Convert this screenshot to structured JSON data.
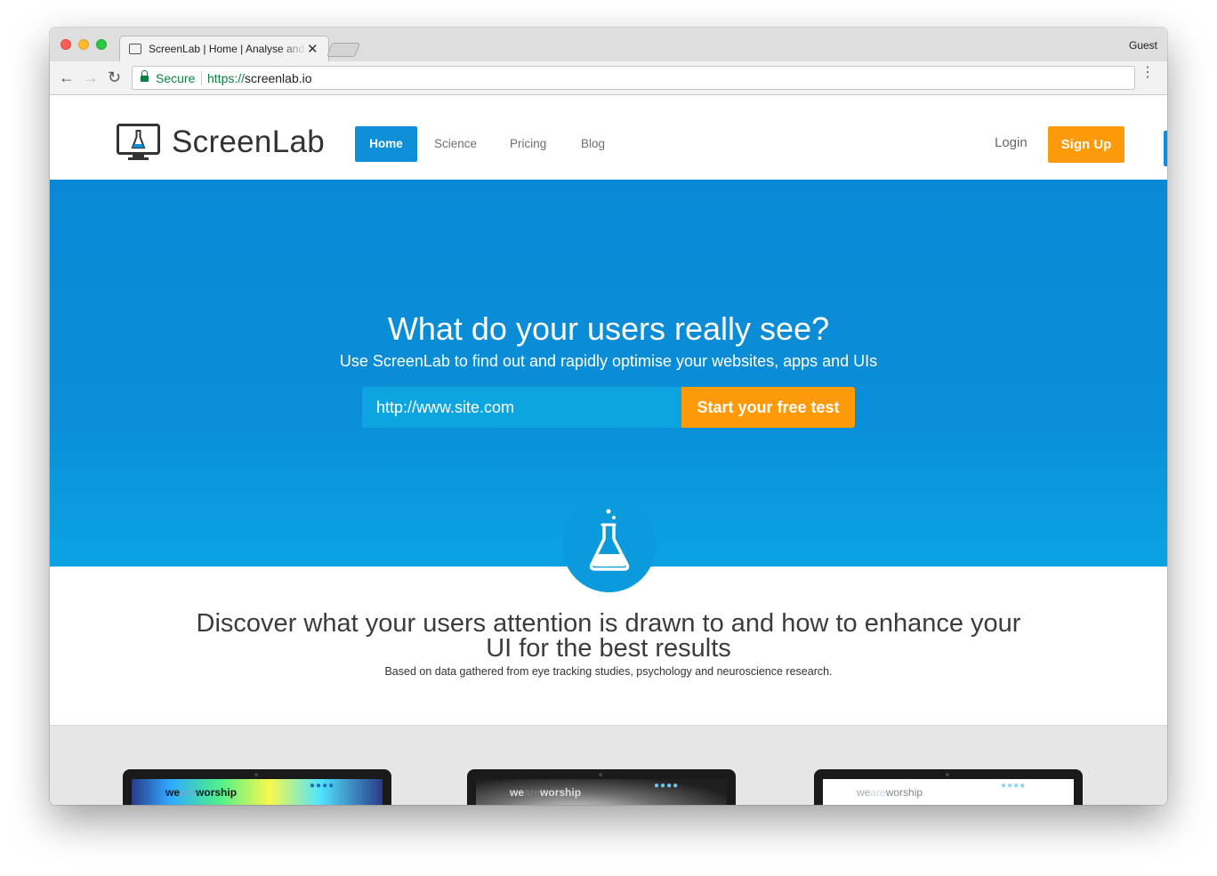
{
  "browser": {
    "tab_title": "ScreenLab | Home | Analyse and",
    "profile": "Guest",
    "secure_label": "Secure",
    "url_scheme": "https://",
    "url_host": "screenlab.io"
  },
  "header": {
    "logo_text": "ScreenLab",
    "nav": {
      "home": "Home",
      "science": "Science",
      "pricing": "Pricing",
      "blog": "Blog"
    },
    "login": "Login",
    "signup": "Sign Up"
  },
  "hero": {
    "title": "What do your users really see?",
    "subtitle": "Use ScreenLab to find out and rapidly optimise your websites, apps and UIs",
    "url_placeholder": "http://www.site.com",
    "cta": "Start your free test"
  },
  "discover": {
    "title": "Discover what your users attention is drawn to and how to enhance your UI for the best results",
    "subtitle": "Based on data gathered from eye tracking studies, psychology and neuroscience research."
  },
  "gallery": {
    "screens": [
      {
        "caption": "weareworship",
        "prefix": "we",
        "infix": "are",
        "suffix": "worship"
      },
      {
        "caption": "weareworship",
        "prefix": "we",
        "infix": "are",
        "suffix": "worship"
      },
      {
        "caption": "weareworship",
        "prefix": "we",
        "infix": "are",
        "suffix": "worship"
      }
    ]
  },
  "colors": {
    "brand_blue": "#0e8fd8",
    "hero_blue": "#0a8ed7",
    "accent_orange": "#fd9a09"
  },
  "icons": {
    "logo": "monitor-flask-icon",
    "hero_badge": "flask-icon",
    "secure": "lock-icon"
  }
}
